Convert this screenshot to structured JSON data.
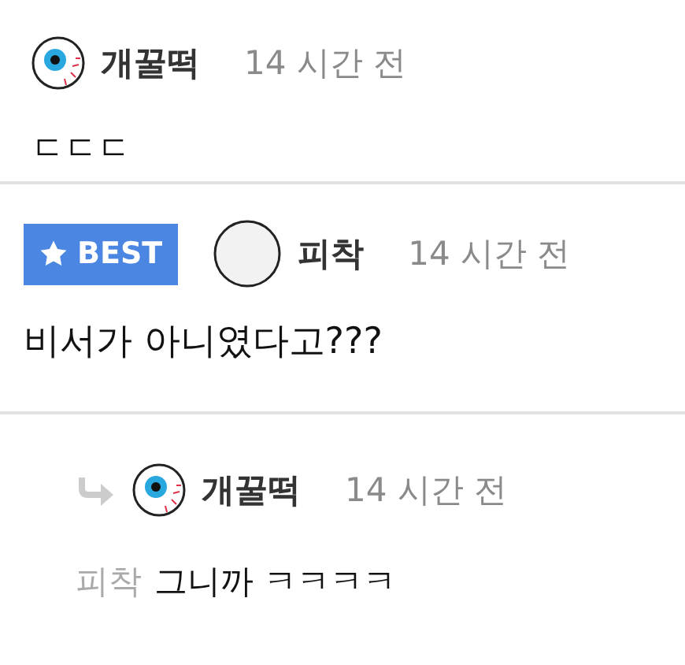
{
  "comments": [
    {
      "kind": "comment",
      "best": false,
      "avatar": {
        "kind": "eyeball"
      },
      "author": "개꿀떡",
      "time": "14 시간 전",
      "text": "ㄷㄷㄷ"
    },
    {
      "kind": "comment",
      "best": true,
      "badge": "BEST",
      "avatar": {
        "kind": "plain"
      },
      "author": "피착",
      "time": "14 시간 전",
      "text": "비서가 아니였다고???"
    },
    {
      "kind": "reply",
      "best": false,
      "avatar": {
        "kind": "eyeball"
      },
      "author": "개꿀떡",
      "time": "14 시간 전",
      "reply_to": "피착",
      "text": "그니까 ㅋㅋㅋㅋ"
    }
  ]
}
